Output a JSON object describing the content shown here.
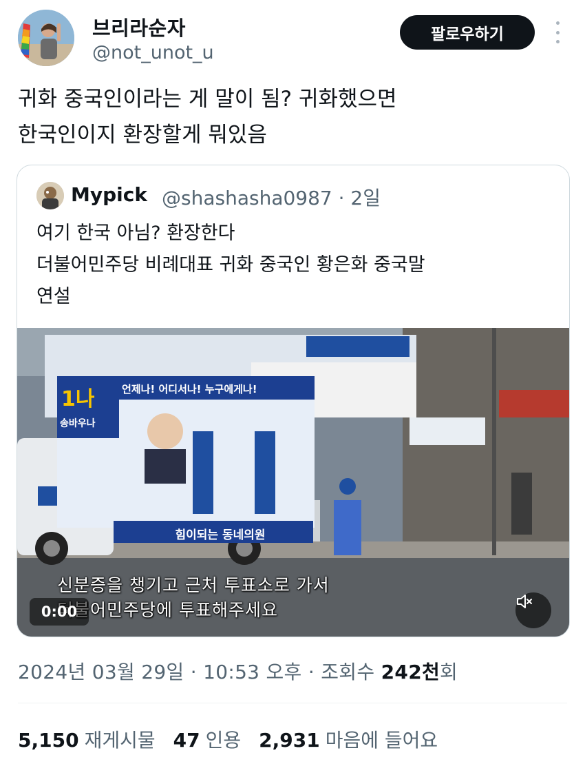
{
  "author": {
    "display_name": "브리라순자",
    "handle": "@not_unot_u",
    "follow_label": "팔로우하기",
    "avatar_icon": "profile-photo-rainbow-flag"
  },
  "tweet": {
    "text": "귀화 중국인이라는 게 말이 됨? 귀화했으면\n한국인이지 환장할게 뭐있음"
  },
  "quote": {
    "name": "Mypick",
    "handle_time": "@shashasha0987 · 2일",
    "text": "여기 한국 아님?  환장한다\n더불어민주당 비례대표 귀화 중국인 황은화 중국말\n연설",
    "video": {
      "subtitle_line1": "신분증을 챙기고 근처 투표소로 가서",
      "subtitle_line2": "더불어민주당에 투표해주세요",
      "time": "0:00",
      "mute_icon": "speaker-muted-icon",
      "sign_top": "언제나! 어디서나! 누구에게나!",
      "sign_bottom": "힘이되는 동네의원",
      "sign_number": "1나",
      "sign_name": "송바우나"
    }
  },
  "meta": {
    "date": "2024년 03월 29일",
    "time": "10:53 오후",
    "views_label": "조회수",
    "views_count": "242천",
    "views_suffix": "회"
  },
  "stats": {
    "retweets_count": "5,150",
    "retweets_label": "재게시물",
    "quotes_count": "47",
    "quotes_label": "인용",
    "likes_count": "2,931",
    "likes_label": "마음에 들어요"
  },
  "colors": {
    "text": "#0f1419",
    "secondary": "#536471",
    "border": "#cfd9de",
    "button": "#0f1419"
  }
}
